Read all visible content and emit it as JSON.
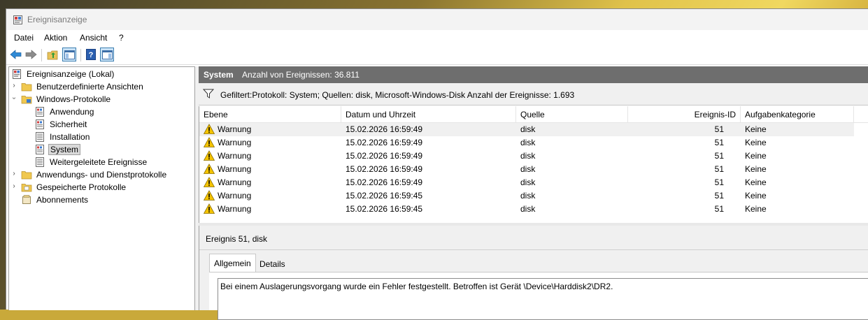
{
  "window": {
    "title": "Ereignisanzeige"
  },
  "menu": [
    "Datei",
    "Aktion",
    "Ansicht",
    "?"
  ],
  "tree": {
    "items": [
      {
        "label": "Ereignisanzeige (Lokal)",
        "icon": "event-viewer-icon"
      },
      {
        "label": "Benutzerdefinierte Ansichten",
        "icon": "folder-icon"
      },
      {
        "label": "Windows-Protokolle",
        "icon": "folder-icon"
      },
      {
        "label": "Anwendung",
        "icon": "log-icon"
      },
      {
        "label": "Sicherheit",
        "icon": "log-icon"
      },
      {
        "label": "Installation",
        "icon": "log-icon"
      },
      {
        "label": "System",
        "icon": "log-icon"
      },
      {
        "label": "Weitergeleitete Ereignisse",
        "icon": "log-icon"
      },
      {
        "label": "Anwendungs- und Dienstprotokolle",
        "icon": "folder-icon"
      },
      {
        "label": "Gespeicherte Protokolle",
        "icon": "folder-icon"
      },
      {
        "label": "Abonnements",
        "icon": "subscriptions-icon"
      }
    ]
  },
  "pane": {
    "name": "System",
    "count": "Anzahl von Ereignissen: 36.811",
    "filter": "Gefiltert:Protokoll: System; Quellen: disk, Microsoft-Windows-Disk Anzahl der Ereignisse: 1.693"
  },
  "grid": {
    "columns": [
      "Ebene",
      "Datum und Uhrzeit",
      "Quelle",
      "Ereignis-ID",
      "Aufgabenkategorie"
    ],
    "rows": [
      {
        "level": "Warnung",
        "datetime": "15.02.2026 16:59:49",
        "source": "disk",
        "id": "51",
        "category": "Keine"
      },
      {
        "level": "Warnung",
        "datetime": "15.02.2026 16:59:49",
        "source": "disk",
        "id": "51",
        "category": "Keine"
      },
      {
        "level": "Warnung",
        "datetime": "15.02.2026 16:59:49",
        "source": "disk",
        "id": "51",
        "category": "Keine"
      },
      {
        "level": "Warnung",
        "datetime": "15.02.2026 16:59:49",
        "source": "disk",
        "id": "51",
        "category": "Keine"
      },
      {
        "level": "Warnung",
        "datetime": "15.02.2026 16:59:49",
        "source": "disk",
        "id": "51",
        "category": "Keine"
      },
      {
        "level": "Warnung",
        "datetime": "15.02.2026 16:59:45",
        "source": "disk",
        "id": "51",
        "category": "Keine"
      },
      {
        "level": "Warnung",
        "datetime": "15.02.2026 16:59:45",
        "source": "disk",
        "id": "51",
        "category": "Keine"
      }
    ]
  },
  "detail": {
    "title": "Ereignis 51, disk",
    "tabs": [
      "Allgemein",
      "Details"
    ],
    "description": "Bei einem Auslagerungsvorgang wurde ein Fehler festgestellt. Betroffen ist Gerät \\Device\\Harddisk2\\DR2."
  },
  "colors": {
    "header_bg": "#6e6e6e",
    "selection_bg": "#d9d9d9",
    "warning_yellow": "#f5c400"
  }
}
